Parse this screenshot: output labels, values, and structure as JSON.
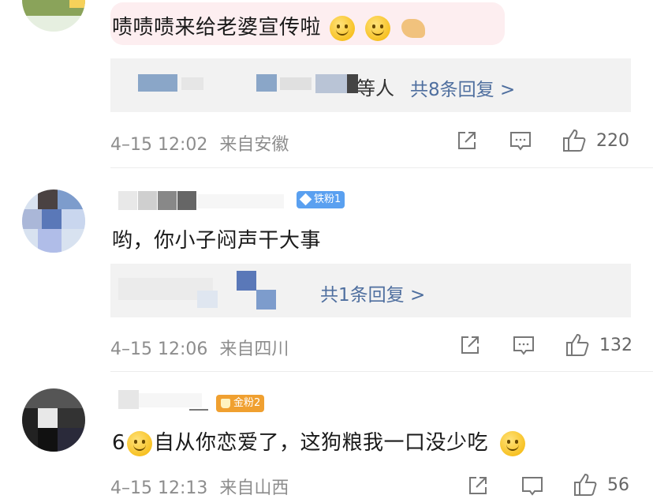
{
  "comment1": {
    "text": "啧啧啧来给老婆宣传啦",
    "reply_suffix": "等人",
    "reply_link": "共8条回复 >",
    "time": "4–15 12:02",
    "location": "来自安徽",
    "likes": "220"
  },
  "comment2": {
    "badge": "铁粉1",
    "text": "哟，你小子闷声干大事",
    "reply_link": "共1条回复 >",
    "time": "4–15 12:06",
    "location": "来自四川",
    "likes": "132"
  },
  "comment3": {
    "badge": "金粉2",
    "text_prefix": "6",
    "text_main": "自从你恋爱了，这狗粮我一口没少吃",
    "time": "4–15 12:13",
    "location": "来自山西",
    "likes": "56"
  },
  "colors": {
    "link": "#4f6f9f",
    "badge_blue": "#5aa0f0",
    "badge_gold": "#f0a030",
    "highlight": "#fdeef0"
  },
  "icons": [
    "share-icon",
    "comment-icon",
    "like-icon",
    "diamond-icon",
    "crown-icon",
    "smile-emoji"
  ]
}
